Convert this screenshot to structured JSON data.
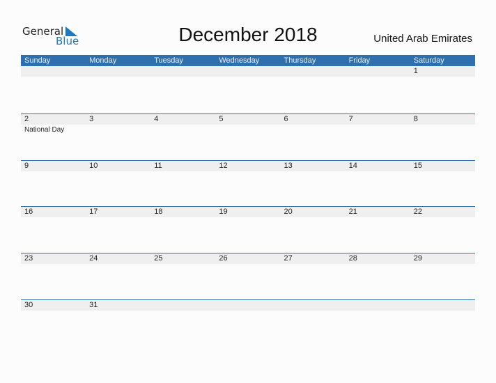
{
  "logo": {
    "line1": "General",
    "line2": "Blue"
  },
  "title": "December 2018",
  "country": "United Arab Emirates",
  "weekdays": [
    "Sunday",
    "Monday",
    "Tuesday",
    "Wednesday",
    "Thursday",
    "Friday",
    "Saturday"
  ],
  "weeks": [
    [
      "",
      "",
      "",
      "",
      "",
      "",
      "1"
    ],
    [
      "2",
      "3",
      "4",
      "5",
      "6",
      "7",
      "8"
    ],
    [
      "9",
      "10",
      "11",
      "12",
      "13",
      "14",
      "15"
    ],
    [
      "16",
      "17",
      "18",
      "19",
      "20",
      "21",
      "22"
    ],
    [
      "23",
      "24",
      "25",
      "26",
      "27",
      "28",
      "29"
    ],
    [
      "30",
      "31",
      "",
      "",
      "",
      "",
      ""
    ]
  ],
  "events": [
    {
      "week": 1,
      "day": 0,
      "label": "National Day"
    }
  ],
  "colors": {
    "header": "#2e6faf",
    "band": "#efefef",
    "brand": "#1b78c2"
  }
}
